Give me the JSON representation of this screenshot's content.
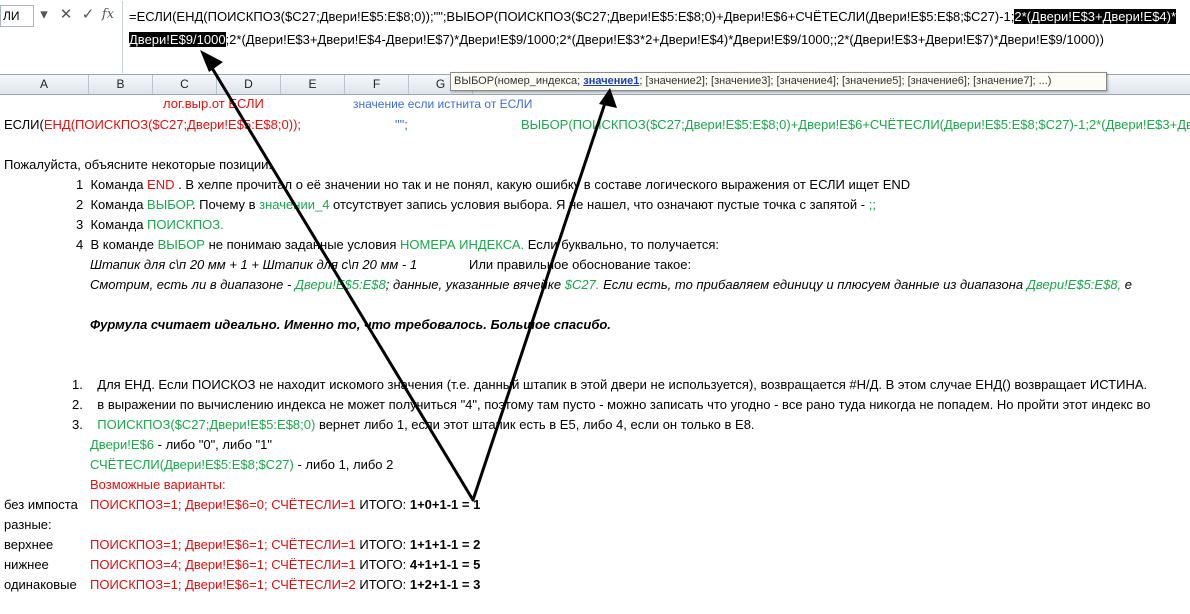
{
  "namebox": "ЛИ",
  "formula_buttons": [
    "▾",
    "✕",
    "✓",
    "fx"
  ],
  "formula": {
    "line1_a": "=ЕСЛИ(ЕНД(ПОИСКПОЗ($C27;Двери!E$5:E$8;0));\"\";ВЫБОР(ПОИСКПОЗ($C27;Двери!E$5:E$8;0)+Двери!E$6+СЧЁТЕСЛИ(Двери!E$5:E$8;$C27)-1;",
    "line1_hl": "2*(Двери!E$3+Двери!E$4)*",
    "line2_hl": "Двери!E$9/1000",
    "line2_b": ";2*(Двери!E$3+Двери!E$4-Двери!E$7)*Двери!E$9/1000;2*(Двери!E$3*2+Двери!E$4)*Двери!E$9/1000;;2*(Двери!E$3+Двери!E$7)*Двери!E$9/1000))"
  },
  "columns": [
    "A",
    "B",
    "C",
    "D",
    "E",
    "F",
    "G"
  ],
  "tooltip": {
    "pre": "ВЫБОР(номер_индекса; ",
    "bold": "значение1",
    "post": "; [значение2]; [значение3]; [значение4]; [значение5]; [значение6]; [значение7]; ...)"
  },
  "labels": {
    "logical": "лог.выр.от ЕСЛИ",
    "true_value": "значение если истнита от ЕСЛИ"
  },
  "row_formula": {
    "a": "ЕСЛИ(",
    "b": "ЕНД(ПОИСКПОЗ($C27;Двери!E$5:E$8;0));",
    "c": "\"\";",
    "d": "ВЫБОР(ПОИСКПОЗ($C27;Двери!E$5:E$8;0)+Двери!E$6+СЧЁТЕСЛИ(Двери!E$5:E$8;$C27)-1;2*(Двери!E$3+Две"
  },
  "question_title": "Пожалуйста, объясните некоторые позиции:",
  "questions": [
    {
      "n": "1",
      "parts": [
        [
          "Команда ",
          ""
        ],
        [
          "END",
          ""
        ],
        [
          " . В хелпе прочитал о её значении но так и не понял, какую ошибку в составе логического выражения от ЕСЛИ ищет END",
          ""
        ]
      ]
    },
    {
      "n": "2",
      "parts": [
        [
          "Команда ",
          ""
        ],
        [
          "ВЫБОР",
          ""
        ],
        [
          ". Почему в ",
          ""
        ],
        [
          "значении_4",
          ""
        ],
        [
          " отсутствует запись условия выбора. Я не нашел, что означают пустые точка с запятой -  ",
          ""
        ],
        [
          ";;",
          ""
        ]
      ]
    },
    {
      "n": "3",
      "parts": [
        [
          "Команда ",
          ""
        ],
        [
          "ПОИСКПОЗ.",
          ""
        ]
      ]
    },
    {
      "n": "4",
      "parts": [
        [
          "В команде ",
          ""
        ],
        [
          "ВЫБОР",
          ""
        ],
        [
          " не понимаю заданные условия ",
          ""
        ],
        [
          "НОМЕРА ИНДЕКСА.",
          ""
        ],
        [
          " Если буквально, то получается:",
          ""
        ]
      ]
    }
  ],
  "q4_line1": "Штапик для с\\п 20 мм + 1 + Штапик для с\\п 20 мм - 1",
  "q4_line1b": "Или правильное обоснование такое:",
  "q4_line2_a": "Смотрим, есть ли в диапазоне  - ",
  "q4_line2_b": "Двери!E$5:E$8",
  "q4_line2_c": "; данные, указанные вячейке  ",
  "q4_line2_d": "$C27.",
  "q4_line2_e": "  Если есть, то прибавляем единицу и плюсуем данные из диапазона ",
  "q4_line2_f": "Двери!E$5:E$8,",
  "q4_line2_g": "  е",
  "thanks": "Фурмула считает идеально. Именно то, что требовалось. Большое спасибо.",
  "answers": [
    {
      "n": "1.",
      "text": "Для ЕНД. Если ПОИСКОЗ не находит искомого значения (т.е. данный штапик в этой двери не используется), возвращается #Н/Д. В этом случае ЕНД() возвращает ИСТИНА."
    },
    {
      "n": "2.",
      "text": "в выражении по вычислению индекса не может получиться \"4\", поэтому там пусто - можно записать что угодно - все рано туда никогда не попадем. Но пройти этот индекс во"
    },
    {
      "n": "3.",
      "text_a": "ПОИСКПОЗ($C27;Двери!E$5:E$8;0)",
      "text_b": " вернет либо 1, если этот штапик есть в E5, либо 4, если он только в E8."
    }
  ],
  "detail1_a": "Двери!E$6",
  "detail1_b": " -  либо \"0\", либо \"1\"",
  "detail2_a": "СЧЁТЕСЛИ(Двери!E$5:E$8;$C27)",
  "detail2_b": " - либо 1, либо 2",
  "variants_title": "Возможные варианты:",
  "variants": [
    {
      "label": "без импоста",
      "cond": "ПОИСКПОЗ=1; Двери!E$6=0; СЧЁТЕСЛИ=1",
      "total_label": " ИТОГО: ",
      "total": "1+0+1-1 = 1"
    },
    {
      "label": "разные:",
      "cond": "",
      "total_label": "",
      "total": ""
    },
    {
      "label": "верхнее",
      "cond": "ПОИСКПОЗ=1; Двери!E$6=1; СЧЁТЕСЛИ=1",
      "total_label": " ИТОГО: ",
      "total": "1+1+1-1 = 2"
    },
    {
      "label": "нижнее",
      "cond": "ПОИСКПОЗ=4; Двери!E$6=1; СЧЁТЕСЛИ=1",
      "total_label": " ИТОГО: ",
      "total": "4+1+1-1 = 5"
    },
    {
      "label": "одинаковые",
      "cond": "ПОИСКПОЗ=1; Двери!E$6=1; СЧЁТЕСЛИ=2",
      "total_label": " ИТОГО: ",
      "total": "1+2+1-1 = 3"
    }
  ]
}
